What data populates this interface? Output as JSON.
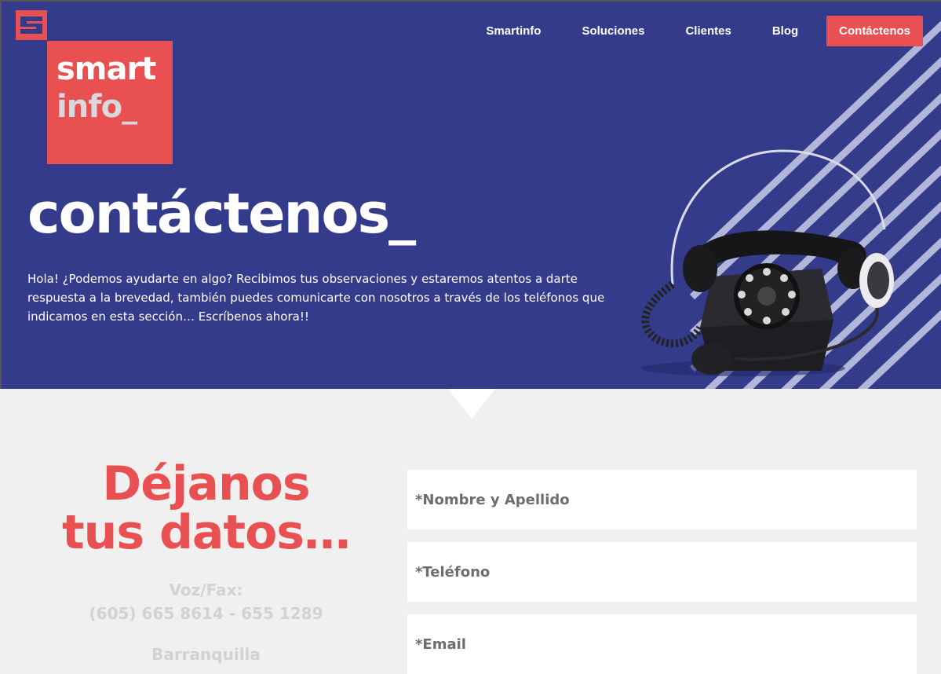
{
  "brand": {
    "logo_line1": "smart",
    "logo_line2": "info_",
    "accent_color": "#e85052",
    "hero_bg": "#333b8a"
  },
  "nav": {
    "items": [
      "Smartinfo",
      "Soluciones",
      "Clientes",
      "Blog"
    ],
    "cta": "Contáctenos"
  },
  "hero": {
    "title": "contáctenos_",
    "text": "Hola! ¿Podemos ayudarte en algo? Recibimos tus observaciones y estaremos atentos a darte respuesta a la brevedad, también puedes comunicarte con nosotros a través de los teléfonos que indicamos en esta sección… Escríbenos ahora!!",
    "image_icon": "rotary-phone-with-headset"
  },
  "contact": {
    "title_line1": "Déjanos",
    "title_line2": "tus datos…",
    "phone_label": "Voz/Fax:",
    "phone_value": "(605) 665 8614 - 655 1289",
    "next_label_partial": "Barranquilla"
  },
  "form": {
    "name_placeholder": "*Nombre y Apellido",
    "phone_placeholder": "*Teléfono",
    "email_placeholder": "*Email"
  }
}
